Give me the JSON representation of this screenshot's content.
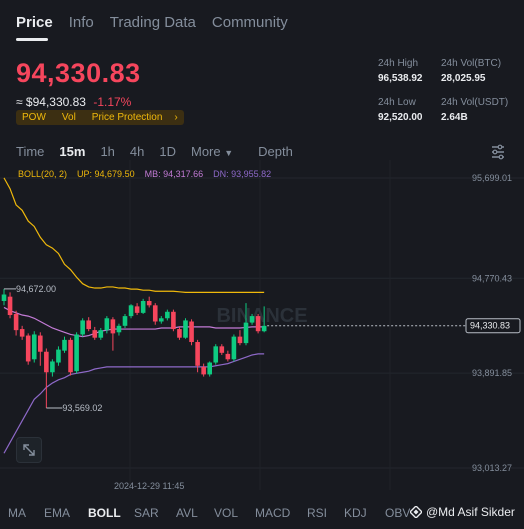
{
  "tabs": [
    "Price",
    "Info",
    "Trading Data",
    "Community"
  ],
  "price": {
    "last": "94,330.83",
    "usd": "≈ $94,330.83",
    "change": "-1.17%"
  },
  "badges": [
    "POW",
    "Vol",
    "Price Protection"
  ],
  "stats": {
    "high_label": "24h High",
    "high_value": "96,538.92",
    "low_label": "24h Low",
    "low_value": "92,520.00",
    "vol_btc_label": "24h Vol(BTC)",
    "vol_btc_value": "28,025.95",
    "vol_usdt_label": "24h Vol(USDT)",
    "vol_usdt_value": "2.64B"
  },
  "intervals": [
    "Time",
    "15m",
    "1h",
    "4h",
    "1D",
    "More",
    "Depth"
  ],
  "legend": {
    "boll": "BOLL(20, 2)",
    "up": "UP: 94,679.50",
    "mb": "MB: 94,317.66",
    "dn": "DN: 93,955.82"
  },
  "axis": {
    "p1": "95,699.01",
    "p2": "94,770.43",
    "p3": "93,891.85",
    "p4": "93,013.27",
    "current": "94,330.83",
    "hi_marker": "94,672.00",
    "lo_marker": "93,569.02",
    "time_label": "2024-12-29 11:45"
  },
  "logo_text": "BINANCE",
  "indicators": [
    "MA",
    "EMA",
    "BOLL",
    "SAR",
    "AVL",
    "VOL",
    "MACD",
    "RSI",
    "KDJ",
    "OBV"
  ],
  "watermark": "@Md Asif Sikder",
  "colors": {
    "up": "#0ecb81",
    "down": "#f6465d",
    "boll_up": "#f0b90b",
    "boll_mb": "#c37bd6",
    "boll_dn": "#8e69c9"
  },
  "chart_data": {
    "type": "candlestick",
    "candles": [
      {
        "o": 94560,
        "c": 94620,
        "h": 94672,
        "l": 94520
      },
      {
        "o": 94600,
        "c": 94430,
        "h": 94640,
        "l": 94400
      },
      {
        "o": 94440,
        "c": 94290,
        "h": 94470,
        "l": 94240
      },
      {
        "o": 94300,
        "c": 94230,
        "h": 94330,
        "l": 94200
      },
      {
        "o": 94240,
        "c": 94000,
        "h": 94260,
        "l": 93970
      },
      {
        "o": 94020,
        "c": 94250,
        "h": 94280,
        "l": 93990
      },
      {
        "o": 94240,
        "c": 94090,
        "h": 94270,
        "l": 93960
      },
      {
        "o": 94090,
        "c": 93900,
        "h": 94120,
        "l": 93569
      },
      {
        "o": 93900,
        "c": 94000,
        "h": 94020,
        "l": 93860
      },
      {
        "o": 93990,
        "c": 94110,
        "h": 94140,
        "l": 93960
      },
      {
        "o": 94100,
        "c": 94200,
        "h": 94230,
        "l": 94080
      },
      {
        "o": 94200,
        "c": 93900,
        "h": 94220,
        "l": 93870
      },
      {
        "o": 93910,
        "c": 94250,
        "h": 94270,
        "l": 93890
      },
      {
        "o": 94250,
        "c": 94380,
        "h": 94400,
        "l": 94230
      },
      {
        "o": 94380,
        "c": 94300,
        "h": 94410,
        "l": 94280
      },
      {
        "o": 94290,
        "c": 94220,
        "h": 94320,
        "l": 94200
      },
      {
        "o": 94220,
        "c": 94290,
        "h": 94310,
        "l": 94200
      },
      {
        "o": 94290,
        "c": 94400,
        "h": 94420,
        "l": 94260
      },
      {
        "o": 94390,
        "c": 94260,
        "h": 94410,
        "l": 94100
      },
      {
        "o": 94270,
        "c": 94330,
        "h": 94350,
        "l": 94240
      },
      {
        "o": 94330,
        "c": 94420,
        "h": 94440,
        "l": 94310
      },
      {
        "o": 94420,
        "c": 94520,
        "h": 94530,
        "l": 94400
      },
      {
        "o": 94510,
        "c": 94450,
        "h": 94540,
        "l": 94430
      },
      {
        "o": 94450,
        "c": 94560,
        "h": 94580,
        "l": 94440
      },
      {
        "o": 94560,
        "c": 94520,
        "h": 94600,
        "l": 94500
      },
      {
        "o": 94520,
        "c": 94370,
        "h": 94540,
        "l": 94340
      },
      {
        "o": 94370,
        "c": 94400,
        "h": 94420,
        "l": 94350
      },
      {
        "o": 94400,
        "c": 94460,
        "h": 94480,
        "l": 94380
      },
      {
        "o": 94460,
        "c": 94300,
        "h": 94480,
        "l": 94280
      },
      {
        "o": 94300,
        "c": 94220,
        "h": 94320,
        "l": 94200
      },
      {
        "o": 94220,
        "c": 94380,
        "h": 94400,
        "l": 94210
      },
      {
        "o": 94370,
        "c": 94180,
        "h": 94390,
        "l": 94150
      },
      {
        "o": 94180,
        "c": 93960,
        "h": 94200,
        "l": 93900
      },
      {
        "o": 93950,
        "c": 93880,
        "h": 93980,
        "l": 93860
      },
      {
        "o": 93880,
        "c": 93990,
        "h": 94000,
        "l": 93860
      },
      {
        "o": 93990,
        "c": 94140,
        "h": 94160,
        "l": 93970
      },
      {
        "o": 94140,
        "c": 94080,
        "h": 94160,
        "l": 94060
      },
      {
        "o": 94070,
        "c": 94020,
        "h": 94100,
        "l": 94000
      },
      {
        "o": 94020,
        "c": 94230,
        "h": 94250,
        "l": 94000
      },
      {
        "o": 94230,
        "c": 94170,
        "h": 94290,
        "l": 94150
      },
      {
        "o": 94170,
        "c": 94360,
        "h": 94540,
        "l": 94150
      },
      {
        "o": 94360,
        "c": 94420,
        "h": 94440,
        "l": 94340
      },
      {
        "o": 94420,
        "c": 94280,
        "h": 94440,
        "l": 94260
      },
      {
        "o": 94280,
        "c": 94330,
        "h": 94510,
        "l": 94270
      }
    ],
    "boll_up": [
      95700,
      95600,
      95450,
      95400,
      95300,
      95250,
      95150,
      95080,
      95050,
      95000,
      94900,
      94850,
      94780,
      94720,
      94690,
      94680,
      94680,
      94690,
      94690,
      94680,
      94680,
      94670,
      94670,
      94660,
      94660,
      94650,
      94650,
      94650,
      94650,
      94645,
      94640,
      94640,
      94640,
      94640,
      94640,
      94640,
      94640,
      94640,
      94640,
      94640,
      94640,
      94640,
      94640,
      94640
    ],
    "boll_mb": [
      94500,
      94470,
      94450,
      94430,
      94420,
      94400,
      94370,
      94340,
      94310,
      94290,
      94270,
      94250,
      94240,
      94230,
      94240,
      94260,
      94280,
      94290,
      94300,
      94300,
      94300,
      94300,
      94300,
      94300,
      94300,
      94300,
      94310,
      94310,
      94310,
      94320,
      94320,
      94320,
      94320,
      94320,
      94320,
      94310,
      94310,
      94310,
      94310,
      94310,
      94315,
      94320,
      94320,
      94320
    ],
    "boll_dn": [
      93150,
      93250,
      93350,
      93450,
      93550,
      93650,
      93700,
      93760,
      93800,
      93830,
      93850,
      93880,
      93890,
      93900,
      93910,
      93930,
      93940,
      93950,
      93950,
      93950,
      93950,
      93950,
      93950,
      93950,
      93950,
      93950,
      93950,
      93950,
      93950,
      93950,
      93950,
      93950,
      93950,
      93950,
      93950,
      93960,
      93970,
      93980,
      94000,
      94020,
      94040,
      94060,
      94070,
      94070
    ],
    "ylim": [
      93013.27,
      95699.01
    ]
  }
}
